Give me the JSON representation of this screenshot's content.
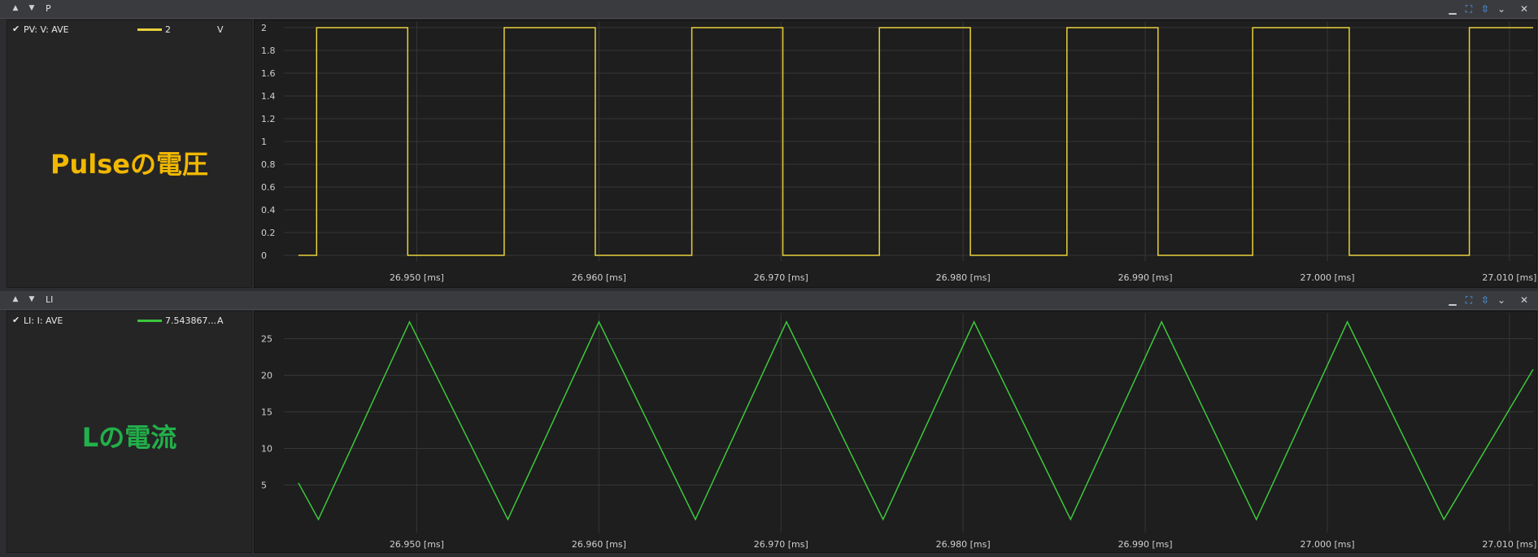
{
  "panels": [
    {
      "title": "P",
      "legend": {
        "name": "PV: V: AVE",
        "value": "2",
        "unit": "V",
        "color": "#e8d03c"
      },
      "big_label": "Pulseの電圧",
      "big_label_color": "#f0b800",
      "y_ticks": [
        "0",
        "0.2",
        "0.4",
        "0.6",
        "0.8",
        "1",
        "1.2",
        "1.4",
        "1.6",
        "1.8",
        "2"
      ],
      "x_ticks": [
        "26.950 [ms]",
        "26.960 [ms]",
        "26.970 [ms]",
        "26.980 [ms]",
        "26.990 [ms]",
        "27.000 [ms]",
        "27.010 [ms]"
      ]
    },
    {
      "title": "LI",
      "legend": {
        "name": "LI: I: AVE",
        "value": "7.543867...",
        "unit": "A",
        "color": "#3cc83c"
      },
      "big_label": "Lの電流",
      "big_label_color": "#22b04a",
      "y_ticks": [
        "5",
        "10",
        "15",
        "20",
        "25"
      ],
      "x_ticks": [
        "26.950 [ms]",
        "26.960 [ms]",
        "26.970 [ms]",
        "26.980 [ms]",
        "26.990 [ms]",
        "27.000 [ms]",
        "27.010 [ms]"
      ]
    }
  ],
  "chart_data": [
    {
      "type": "line",
      "series": [
        {
          "name": "PV: V: AVE",
          "color": "#e8d03c",
          "points": [
            [
              26.9435,
              0
            ],
            [
              26.9445,
              0
            ],
            [
              26.9445,
              2
            ],
            [
              26.9495,
              2
            ],
            [
              26.9495,
              0
            ],
            [
              26.9548,
              0
            ],
            [
              26.9548,
              2
            ],
            [
              26.9598,
              2
            ],
            [
              26.9598,
              0
            ],
            [
              26.9651,
              0
            ],
            [
              26.9651,
              2
            ],
            [
              26.9701,
              2
            ],
            [
              26.9701,
              0
            ],
            [
              26.9754,
              0
            ],
            [
              26.9754,
              2
            ],
            [
              26.9804,
              2
            ],
            [
              26.9804,
              0
            ],
            [
              26.9857,
              0
            ],
            [
              26.9857,
              2
            ],
            [
              26.9907,
              2
            ],
            [
              26.9907,
              0
            ],
            [
              26.9959,
              0
            ],
            [
              26.9959,
              2
            ],
            [
              27.0012,
              2
            ],
            [
              27.0012,
              0
            ],
            [
              27.0078,
              0
            ],
            [
              27.0078,
              2
            ],
            [
              27.0113,
              2
            ]
          ]
        }
      ],
      "xlim": [
        26.9427,
        27.0113
      ],
      "ylim": [
        -0.05,
        2.05
      ],
      "x_ticks": [
        26.95,
        26.96,
        26.97,
        26.98,
        26.99,
        27.0,
        27.01
      ],
      "y_ticks": [
        0,
        0.2,
        0.4,
        0.6,
        0.8,
        1,
        1.2,
        1.4,
        1.6,
        1.8,
        2
      ],
      "grid": true
    },
    {
      "type": "line",
      "series": [
        {
          "name": "LI: I: AVE",
          "color": "#3cc83c",
          "points": [
            [
              26.9435,
              5.3
            ],
            [
              26.9446,
              0.3
            ],
            [
              26.9496,
              27.3
            ],
            [
              26.955,
              0.3
            ],
            [
              26.96,
              27.3
            ],
            [
              26.9653,
              0.3
            ],
            [
              26.9703,
              27.3
            ],
            [
              26.9756,
              0.3
            ],
            [
              26.9806,
              27.3
            ],
            [
              26.9859,
              0.3
            ],
            [
              26.9909,
              27.3
            ],
            [
              26.9961,
              0.3
            ],
            [
              27.0011,
              27.3
            ],
            [
              27.0064,
              0.3
            ],
            [
              27.0113,
              20.8
            ]
          ]
        }
      ],
      "xlim": [
        26.9427,
        27.0113
      ],
      "ylim": [
        -1.5,
        28.5
      ],
      "x_ticks": [
        26.95,
        26.96,
        26.97,
        26.98,
        26.99,
        27.0,
        27.01
      ],
      "y_ticks": [
        5,
        10,
        15,
        20,
        25
      ],
      "grid": true
    }
  ]
}
